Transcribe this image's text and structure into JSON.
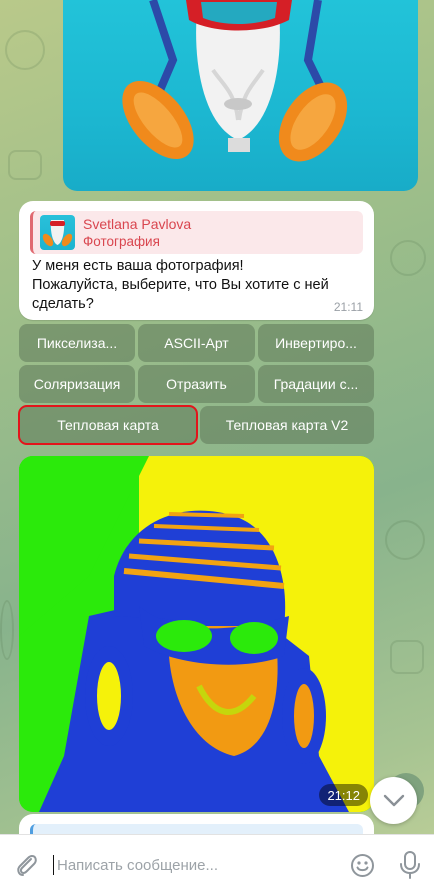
{
  "message": {
    "reply": {
      "author": "Svetlana Pavlova",
      "subtitle": "Фотография"
    },
    "text_line1": "У меня есть ваша фотография!",
    "text_line2": "Пожалуйста, выберите, что Вы хотите с ней",
    "text_line3": "сделать?",
    "time": "21:11"
  },
  "keyboard": {
    "row1": [
      "Пикселиза...",
      "ASCII-Арт",
      "Инвертиро..."
    ],
    "row2": [
      "Соляризация",
      "Отразить",
      "Градации с..."
    ],
    "row3": [
      "Тепловая карта",
      "Тепловая карта V2"
    ],
    "selected": "Тепловая карта"
  },
  "result_photo": {
    "time": "21:12"
  },
  "composer": {
    "placeholder": "Написать сообщение..."
  },
  "colors": {
    "accent_red": "#d9464f",
    "selected_outline": "#e3141b",
    "button_bg": "#5f785a"
  },
  "icons": [
    "paperclip-icon",
    "emoji-icon",
    "microphone-icon",
    "chevron-down-icon"
  ]
}
